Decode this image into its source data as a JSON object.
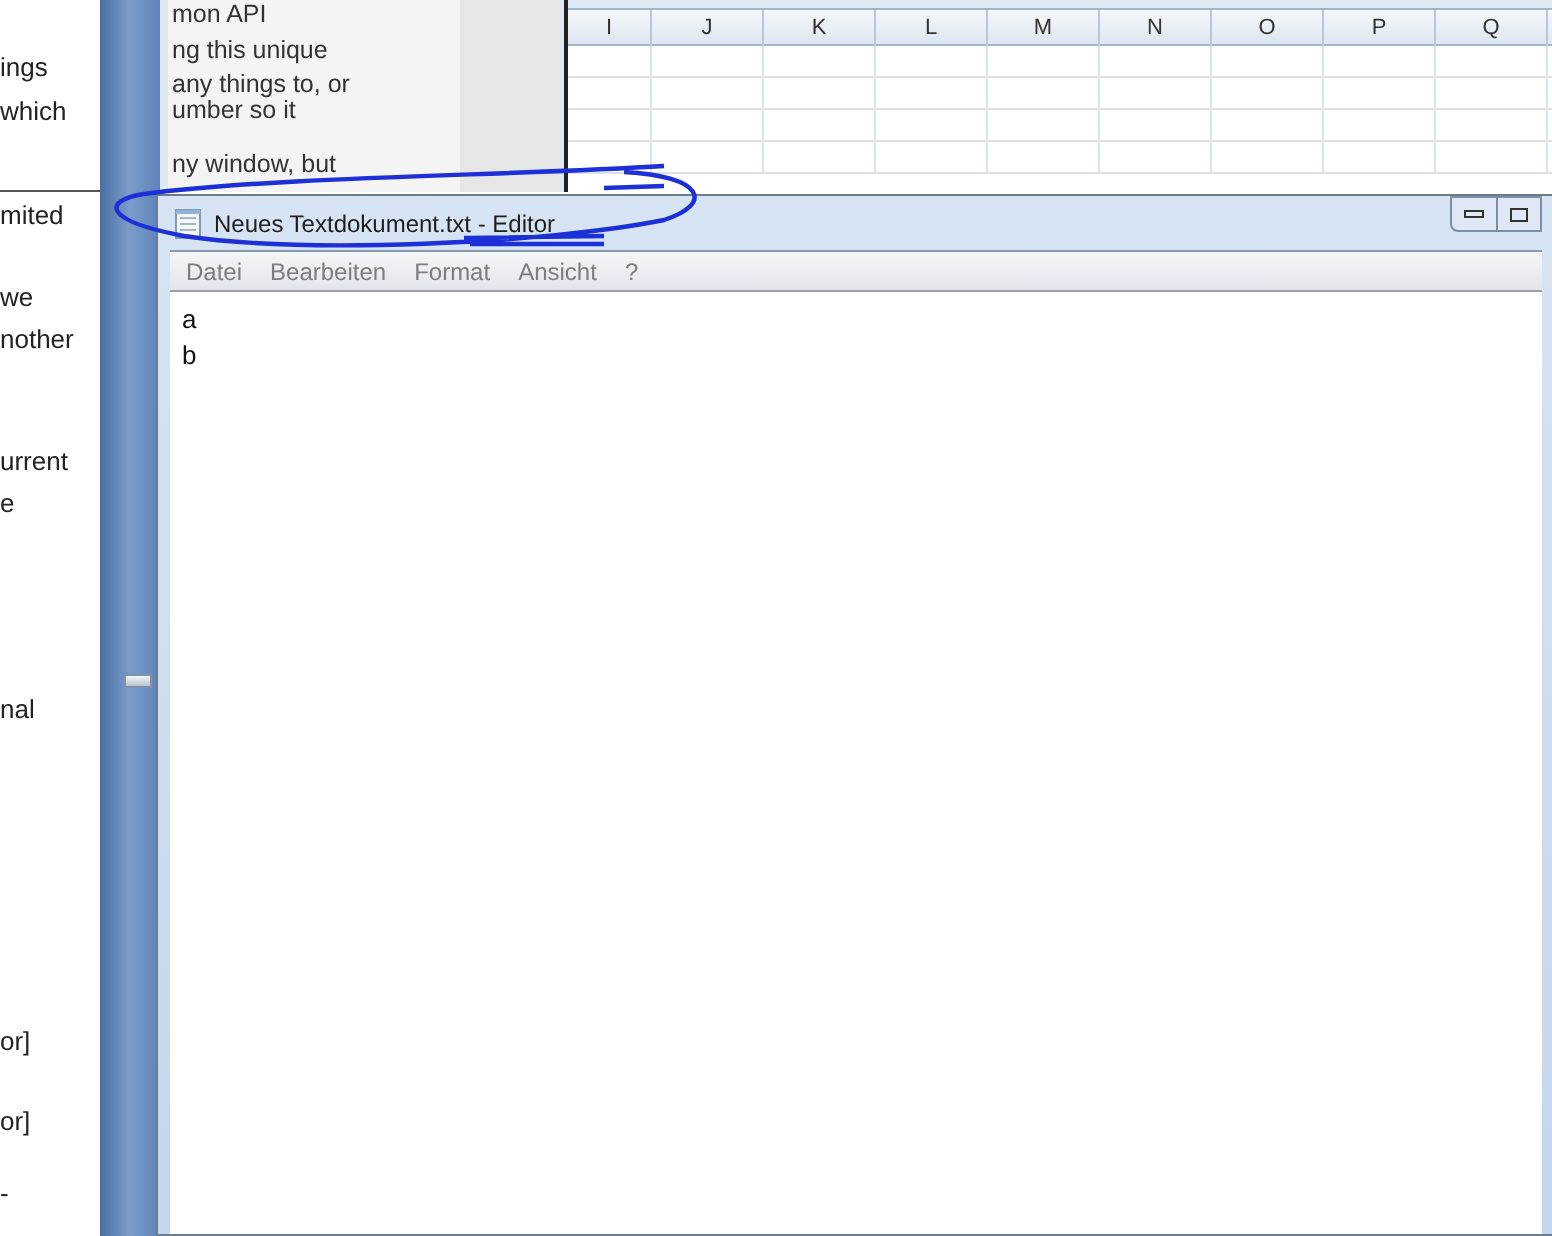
{
  "document_fragment": {
    "lines": [
      "ings",
      "which",
      "mited",
      "we",
      "nother",
      "urrent",
      "e",
      "nal",
      "or]",
      "or]",
      "-"
    ]
  },
  "background_window": {
    "lines": [
      "mon API",
      "ng this unique",
      "any things to, or",
      "umber so it",
      "ny window, but"
    ]
  },
  "spreadsheet": {
    "columns": [
      "I",
      "J",
      "K",
      "L",
      "M",
      "N",
      "O",
      "P",
      "Q"
    ]
  },
  "editor": {
    "title": "Neues Textdokument.txt - Editor",
    "menu": [
      "Datei",
      "Bearbeiten",
      "Format",
      "Ansicht",
      "?"
    ],
    "lines": [
      "a",
      "b"
    ]
  }
}
